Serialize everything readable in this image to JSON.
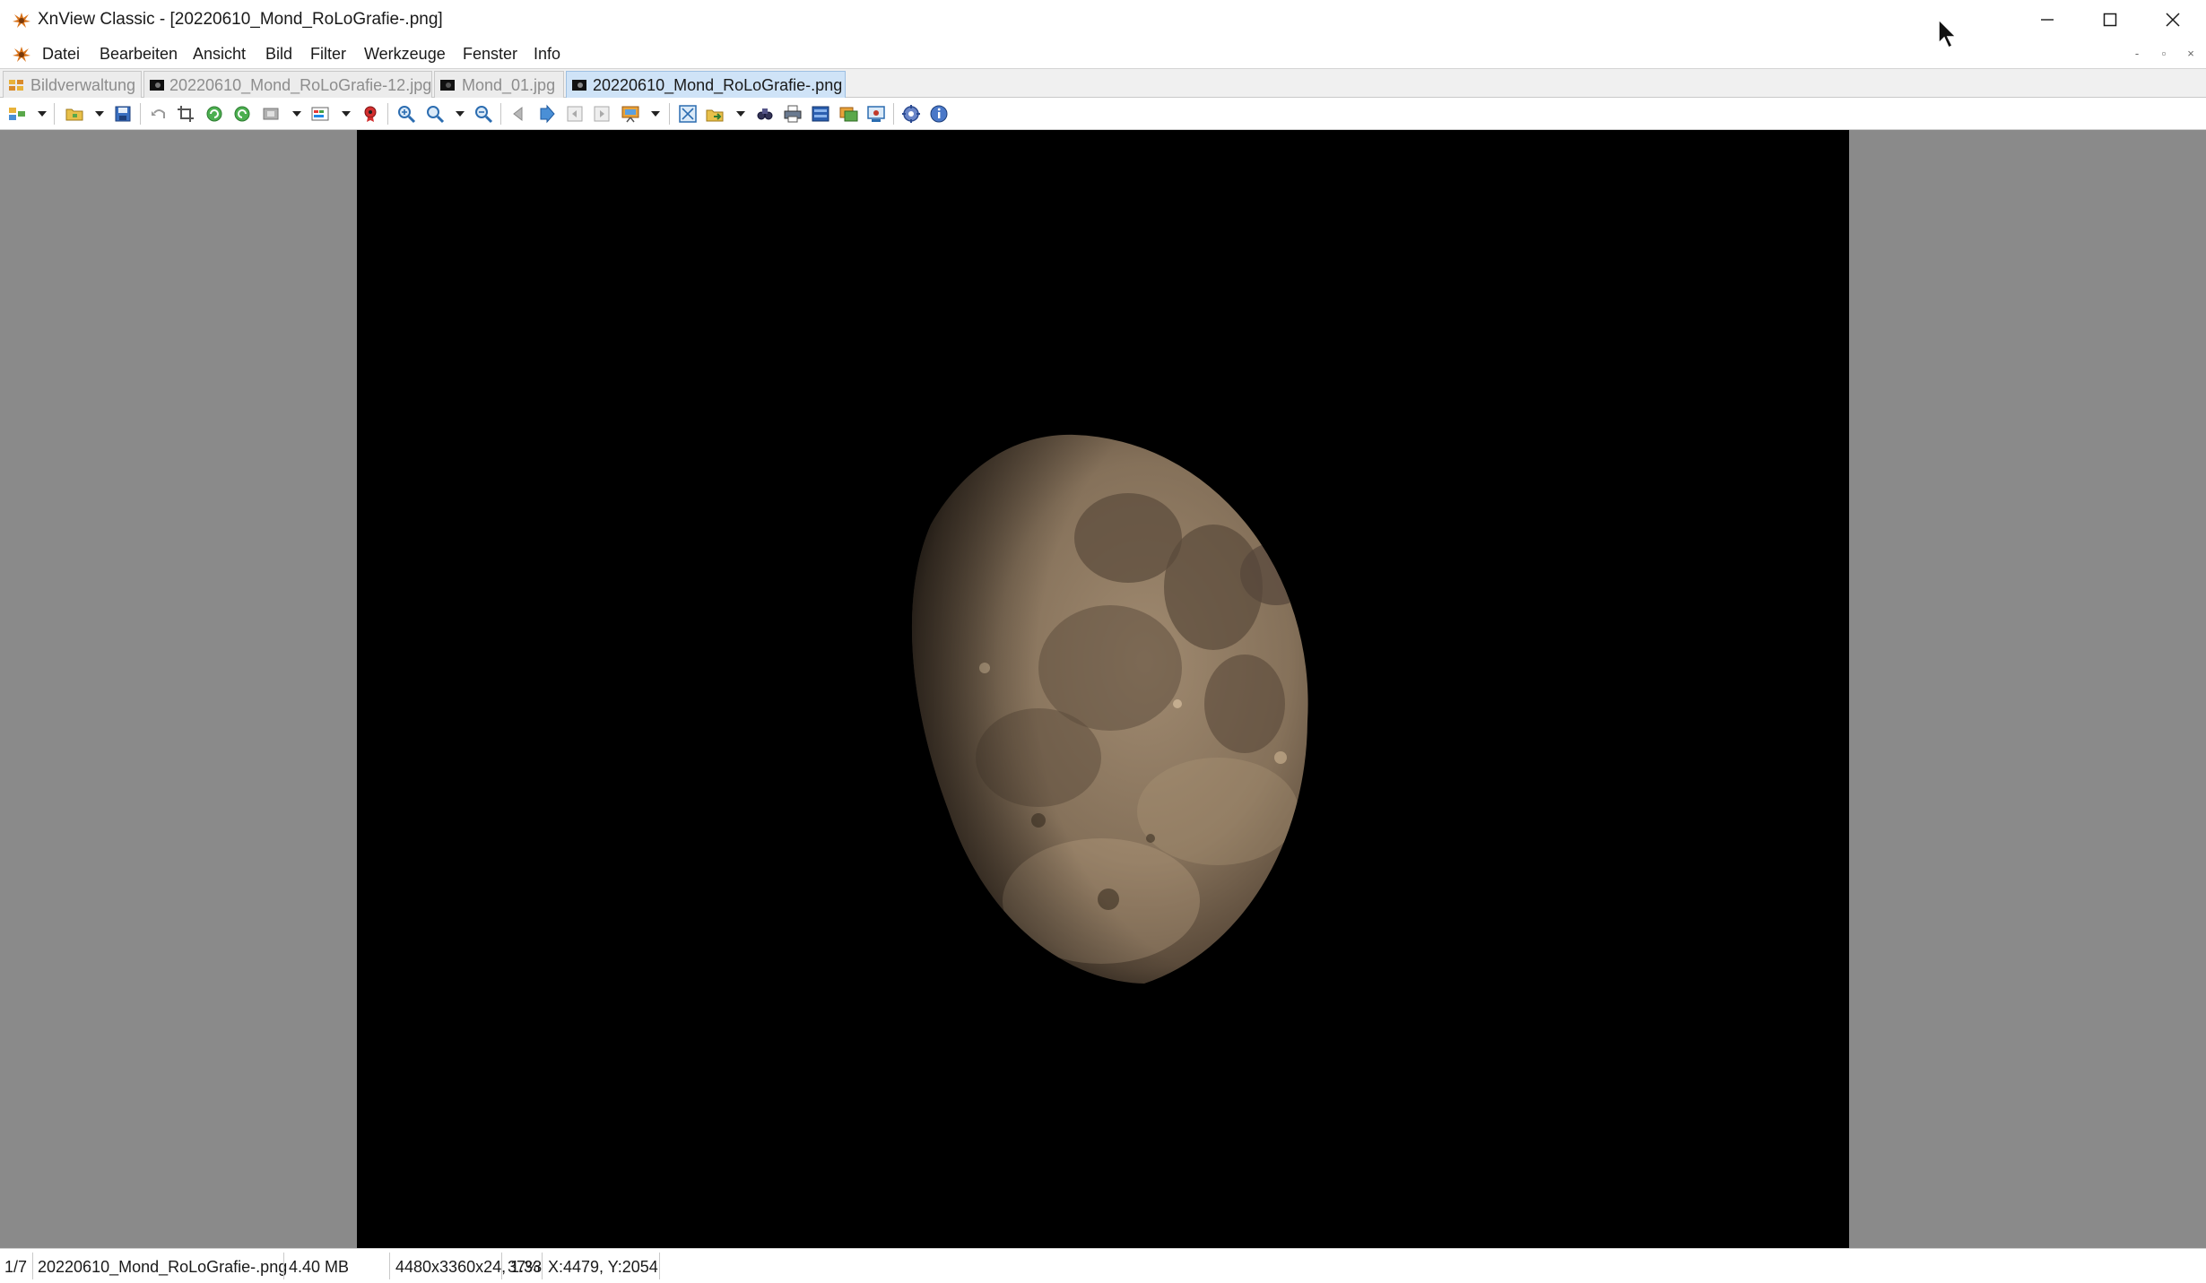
{
  "window": {
    "title": "XnView Classic - [20220610_Mond_RoLoGrafie-.png]",
    "controls": {
      "minimize": "minimize-icon",
      "maximize": "maximize-icon",
      "close": "close-icon"
    }
  },
  "menu": {
    "items": [
      "Datei",
      "Bearbeiten",
      "Ansicht",
      "Bild",
      "Filter",
      "Werkzeuge",
      "Fenster",
      "Info"
    ],
    "mdi_controls": [
      "-",
      "▫",
      "×"
    ]
  },
  "tabs": [
    {
      "label": "Bildverwaltung",
      "icon": "browser-icon",
      "active": false
    },
    {
      "label": "20220610_Mond_RoLoGrafie-12.jpg",
      "icon": "image-thumb-icon",
      "active": false
    },
    {
      "label": "Mond_01.jpg",
      "icon": "image-thumb-icon",
      "active": false
    },
    {
      "label": "20220610_Mond_RoLoGrafie-.png",
      "icon": "image-thumb-icon",
      "active": true
    }
  ],
  "toolbar": {
    "icons": [
      "browser-icon",
      "open-folder-icon",
      "save-icon",
      "undo-icon",
      "crop-icon",
      "rotate-left-icon",
      "rotate-right-icon",
      "resize-icon",
      "adjust-icon",
      "red-eye-icon",
      "zoom-in-icon",
      "zoom-icon",
      "zoom-out-icon",
      "previous-icon",
      "next-icon",
      "first-icon",
      "last-icon",
      "slideshow-icon",
      "fullscreen-icon",
      "export-icon",
      "find-icon",
      "print-icon",
      "scan-icon",
      "capture-icon",
      "screenshot-icon",
      "settings-icon",
      "info-icon"
    ]
  },
  "viewer": {
    "image_description_icon": "moon-photo",
    "colors": {
      "background": "#8a8a8a",
      "image_bg": "#000000",
      "moon_light": "#c2a887",
      "moon_dark": "#4a3c2e"
    }
  },
  "status": {
    "index": "1/7",
    "filename": "20220610_Mond_RoLoGrafie-.png",
    "size": "4.40 MB",
    "dimensions": "4480x3360x24, 1.33",
    "zoom": "37%",
    "coords": "X:4479, Y:2054"
  }
}
